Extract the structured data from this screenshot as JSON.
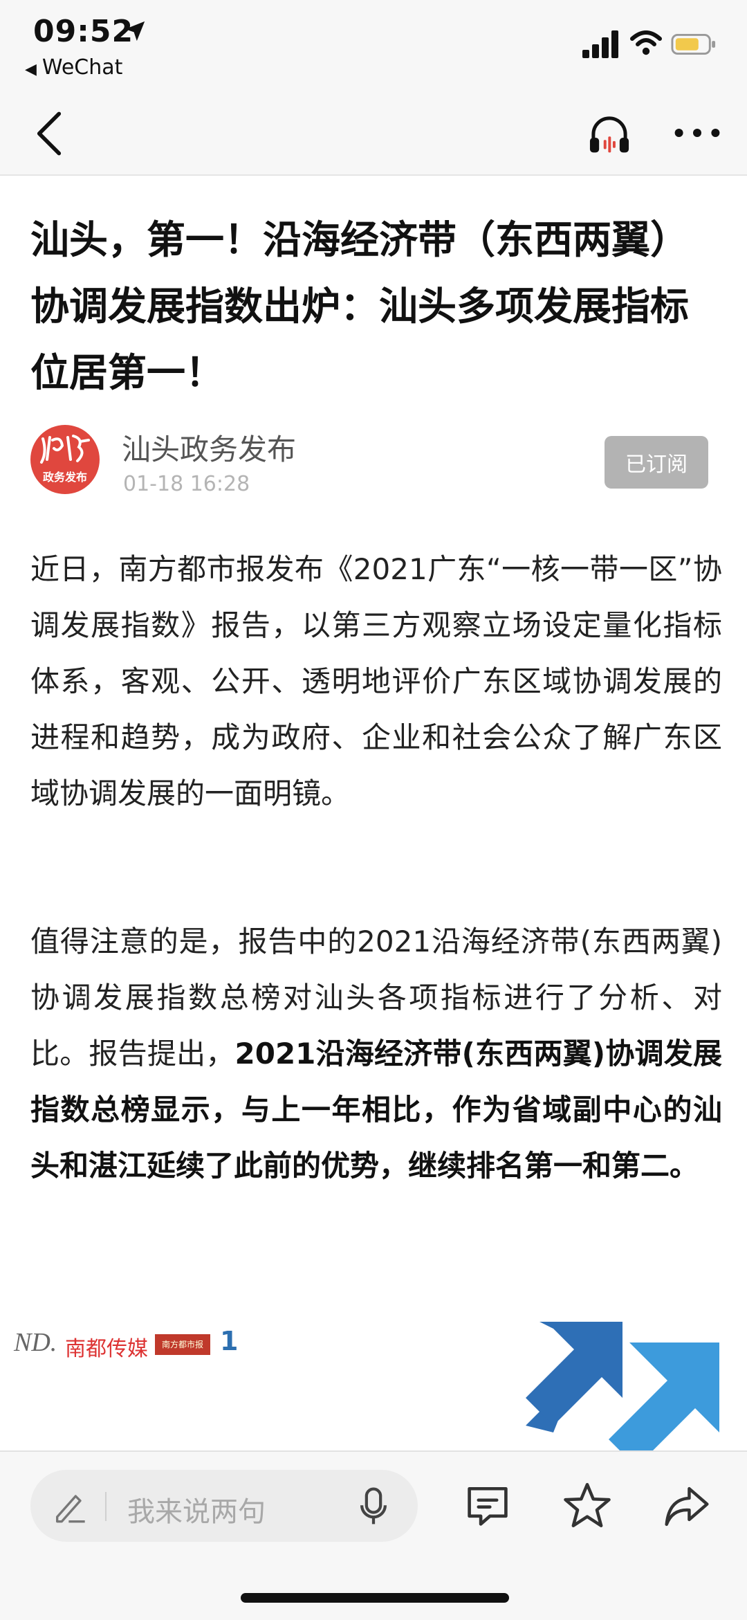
{
  "status_bar": {
    "time": "09:52",
    "back_app": "WeChat",
    "battery_color": "#f2c94c"
  },
  "article": {
    "title": "汕头，第一！沿海经济带（东西两翼）协调发展指数出炉：汕头多项发展指标位居第一！",
    "author": "汕头政务发布",
    "avatar_text": "政务发布",
    "date": "01-18 16:28",
    "subscribe_label": "已订阅",
    "paragraph1": "近日，南方都市报发布《2021广东“一核一带一区”协调发展指数》报告，以第三方观察立场设定量化指标体系，客观、公开、透明地评价广东区域协调发展的进程和趋势，成为政府、企业和社会公众了解广东区域协调发展的一面明镜。",
    "paragraph2_normal": "值得注意的是，报告中的2021沿海经济带(东西两翼)协调发展指数总榜对汕头各项指标进行了分析、对比。报告提出，",
    "paragraph2_bold": "2021沿海经济带(东西两翼)协调发展指数总榜显示，与上一年相比，作为省域副中心的汕头和湛江延续了此前的优势，继续排名第一和第二。"
  },
  "image_strip": {
    "logo_text": "ND.",
    "logo_cn": "南都传媒",
    "badge_text": "南方都市报",
    "one_text": "1"
  },
  "toolbar": {
    "comment_placeholder": "我来说两句"
  },
  "colors": {
    "accent_red": "#e0473e",
    "arrow_dark": "#2e6fb6",
    "arrow_light": "#3d9bdc"
  }
}
